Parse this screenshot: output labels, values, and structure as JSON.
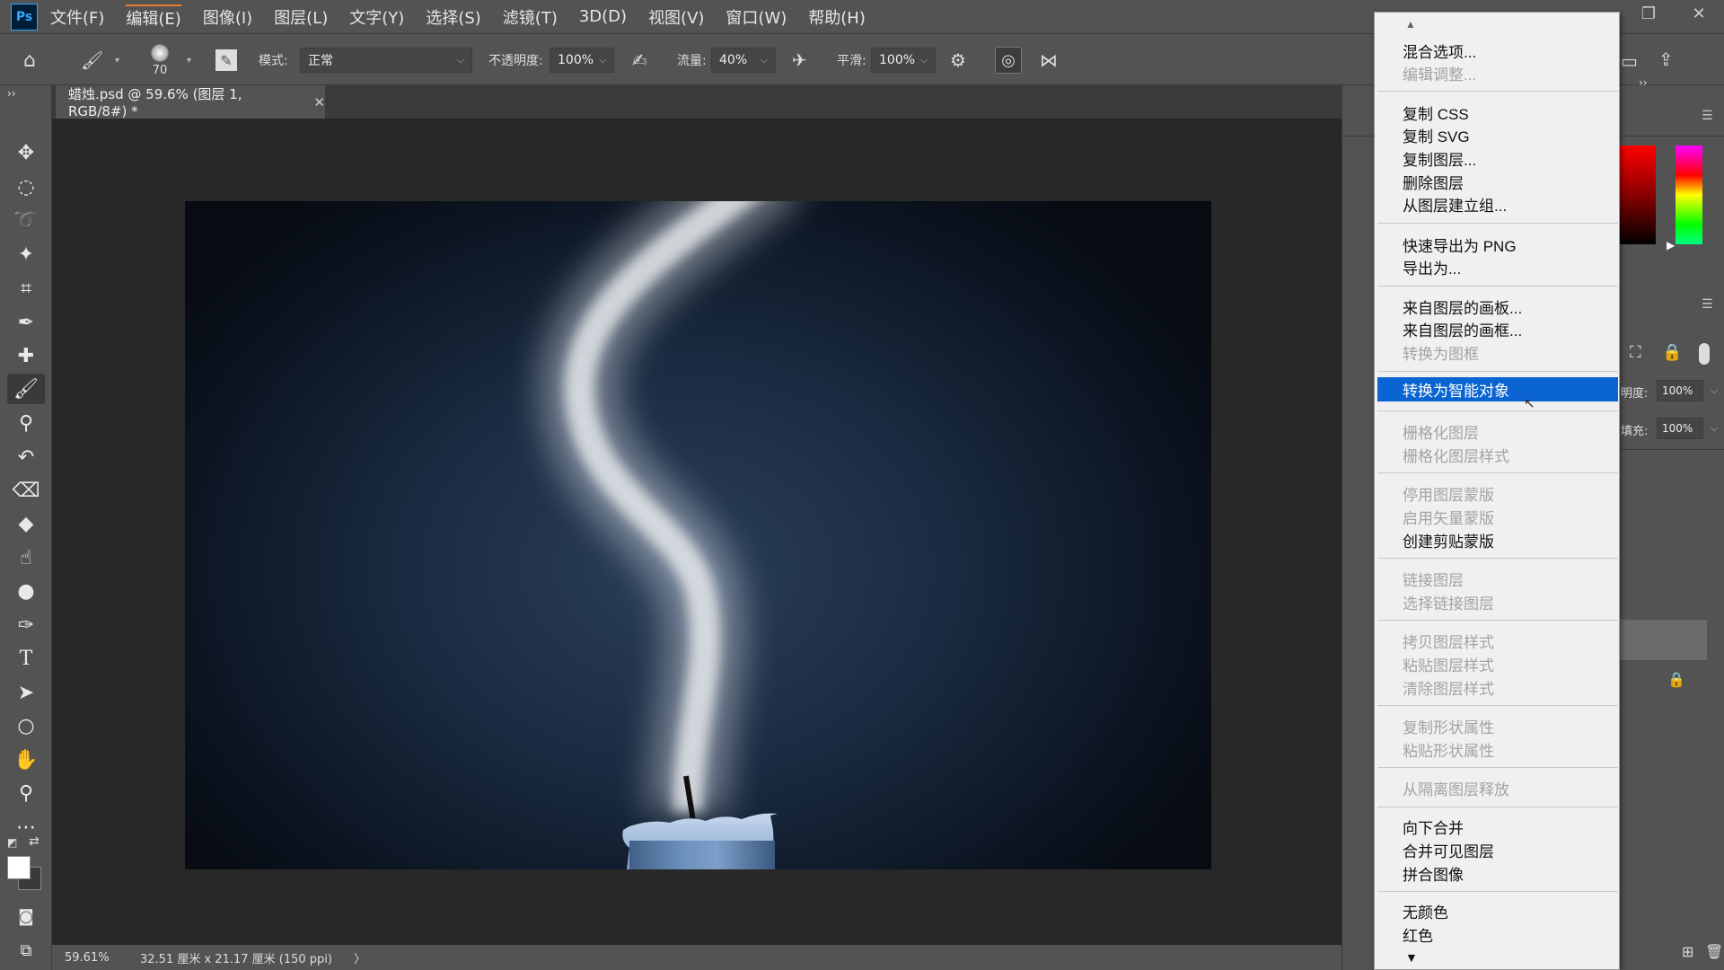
{
  "app": {
    "logo_text": "Ps"
  },
  "menubar": {
    "items": [
      "文件(F)",
      "编辑(E)",
      "图像(I)",
      "图层(L)",
      "文字(Y)",
      "选择(S)",
      "滤镜(T)",
      "3D(D)",
      "视图(V)",
      "窗口(W)",
      "帮助(H)"
    ],
    "active_index": 1
  },
  "window_controls": {
    "restore_icon": "restore-icon",
    "close_icon": "close-icon"
  },
  "options": {
    "brush_size": "70",
    "mode_label": "模式:",
    "mode_value": "正常",
    "opacity_label": "不透明度:",
    "opacity_value": "100%",
    "flow_label": "流量:",
    "flow_value": "40%",
    "smoothing_label": "平滑:",
    "smoothing_value": "100%"
  },
  "document": {
    "tab_title": "蜡烛.psd @ 59.6% (图层 1, RGB/8#) *",
    "zoom": "59.61%",
    "doc_info": "32.51 厘米 x 21.17 厘米 (150 ppi)",
    "status_more": "〉"
  },
  "layers_panel": {
    "opacity_label": "明度:",
    "opacity_value": "100%",
    "fill_label": "填充:",
    "fill_value": "100%"
  },
  "context_menu": {
    "items": [
      {
        "label": "混合选项...",
        "enabled": true
      },
      {
        "label": "编辑调整...",
        "enabled": false
      },
      {
        "label": "复制 CSS",
        "enabled": true
      },
      {
        "label": "复制 SVG",
        "enabled": true
      },
      {
        "label": "复制图层...",
        "enabled": true
      },
      {
        "label": "删除图层",
        "enabled": true
      },
      {
        "label": "从图层建立组...",
        "enabled": true
      },
      {
        "label": "快速导出为 PNG",
        "enabled": true
      },
      {
        "label": "导出为...",
        "enabled": true
      },
      {
        "label": "来自图层的画板...",
        "enabled": true
      },
      {
        "label": "来自图层的画框...",
        "enabled": true
      },
      {
        "label": "转换为图框",
        "enabled": false
      },
      {
        "label": "转换为智能对象",
        "enabled": true,
        "highlighted": true
      },
      {
        "label": "栅格化图层",
        "enabled": false
      },
      {
        "label": "栅格化图层样式",
        "enabled": false
      },
      {
        "label": "停用图层蒙版",
        "enabled": false
      },
      {
        "label": "启用矢量蒙版",
        "enabled": false
      },
      {
        "label": "创建剪贴蒙版",
        "enabled": true
      },
      {
        "label": "链接图层",
        "enabled": false
      },
      {
        "label": "选择链接图层",
        "enabled": false
      },
      {
        "label": "拷贝图层样式",
        "enabled": false
      },
      {
        "label": "粘贴图层样式",
        "enabled": false
      },
      {
        "label": "清除图层样式",
        "enabled": false
      },
      {
        "label": "复制形状属性",
        "enabled": false
      },
      {
        "label": "粘贴形状属性",
        "enabled": false
      },
      {
        "label": "从隔离图层释放",
        "enabled": false
      },
      {
        "label": "向下合并",
        "enabled": true
      },
      {
        "label": "合并可见图层",
        "enabled": true
      },
      {
        "label": "拼合图像",
        "enabled": true
      },
      {
        "label": "无颜色",
        "enabled": true
      },
      {
        "label": "红色",
        "enabled": true
      }
    ]
  },
  "colors": {
    "highlight": "#0a64d2",
    "ui_bg": "#535353",
    "canvas_bg": "#282828"
  }
}
